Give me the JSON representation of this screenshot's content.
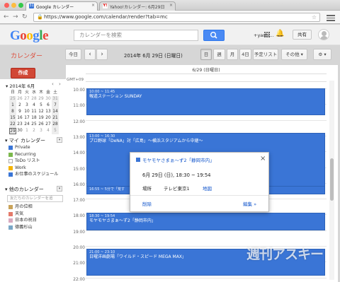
{
  "browser": {
    "tabs": [
      {
        "label": "Google カレンダー",
        "active": true
      },
      {
        "label": "Yahoo!カレンダー: 6月29日",
        "active": false
      }
    ],
    "url": "https://www.google.com/calendar/render?tab=mc"
  },
  "header": {
    "logo": "Google",
    "search_placeholder": "カレンダーを検索",
    "user": "+yashi...",
    "share": "共有"
  },
  "toolbar": {
    "app_title": "カレンダー",
    "today": "今日",
    "prev": "‹",
    "next": "›",
    "date_title": "2014年 6月 29日 (日曜日)",
    "views": [
      "日",
      "週",
      "月",
      "4日",
      "予定リスト"
    ],
    "more": "その他 ▾",
    "settings": "⚙ ▾"
  },
  "sidebar": {
    "create": "作成",
    "mini_title": "2014年 6月",
    "mini_weeks": [
      [
        "25",
        "26",
        "27",
        "28",
        "29",
        "30",
        "31"
      ],
      [
        "1",
        "2",
        "3",
        "4",
        "5",
        "6",
        "7"
      ],
      [
        "8",
        "9",
        "10",
        "11",
        "12",
        "13",
        "14"
      ],
      [
        "15",
        "16",
        "17",
        "18",
        "19",
        "20",
        "21"
      ],
      [
        "22",
        "23",
        "24",
        "25",
        "26",
        "27",
        "28"
      ],
      [
        "29",
        "30",
        "1",
        "2",
        "3",
        "4",
        "5"
      ]
    ],
    "my_calendars_title": "マイ カレンダー",
    "my_calendars": [
      {
        "label": "Private",
        "color": "#3a75d6"
      },
      {
        "label": "Recurring",
        "color": "#7bb84c"
      },
      {
        "label": "ToDo リスト",
        "color": "#ffffff"
      },
      {
        "label": "Work",
        "color": "#f5b400"
      },
      {
        "label": "お仕事のスケジュール",
        "color": "#3a75d6"
      }
    ],
    "other_calendars_title": "他のカレンダー",
    "friend_placeholder": "友だちのカレンダーを追",
    "other_calendars": [
      {
        "label": "月の位相",
        "color": "#c9a35a"
      },
      {
        "label": "天気",
        "color": "#e47a6a"
      },
      {
        "label": "日本の祝日",
        "color": "#d8aabf"
      },
      {
        "label": "德義杉山",
        "color": "#7aa7c7"
      }
    ]
  },
  "grid": {
    "day_header": "6/29 (日曜日)",
    "gmt": "GMT+09",
    "hours": [
      "10:00",
      "11:00",
      "12:00",
      "13:00",
      "14:00",
      "15:00",
      "16:00",
      "17:00",
      "18:00",
      "19:00",
      "20:00",
      "21:00",
      "22:00"
    ],
    "events": [
      {
        "time": "10:00 ~ 11:45",
        "title": "報道ステーション SUNDAY"
      },
      {
        "time": "13:00 ~ 16:30",
        "title": "プロ野球「DeNA」対「広島」～横浜スタジアムから中継～"
      },
      {
        "time": "16:55 ~ 5分で「荒す",
        "title": ""
      },
      {
        "time": "18:30 ~ 19:54",
        "title": "モヤモヤさまぁ～ず2「静岡市内」"
      },
      {
        "time": "21:00 ~ 23:10",
        "title": "日曜洋画劇場「ワイルド・スピード MEGA MAX」"
      }
    ]
  },
  "popup": {
    "title": "モヤモヤさまぁ～ず2「静岡市内」",
    "date": "6月 29日 (日), 18:30 ~ 19:54",
    "location_label": "場所",
    "location": "テレビ東京1",
    "map_link": "地図",
    "delete": "削除",
    "edit": "編集 »",
    "close": "×"
  },
  "watermark": "週刊アスキー"
}
